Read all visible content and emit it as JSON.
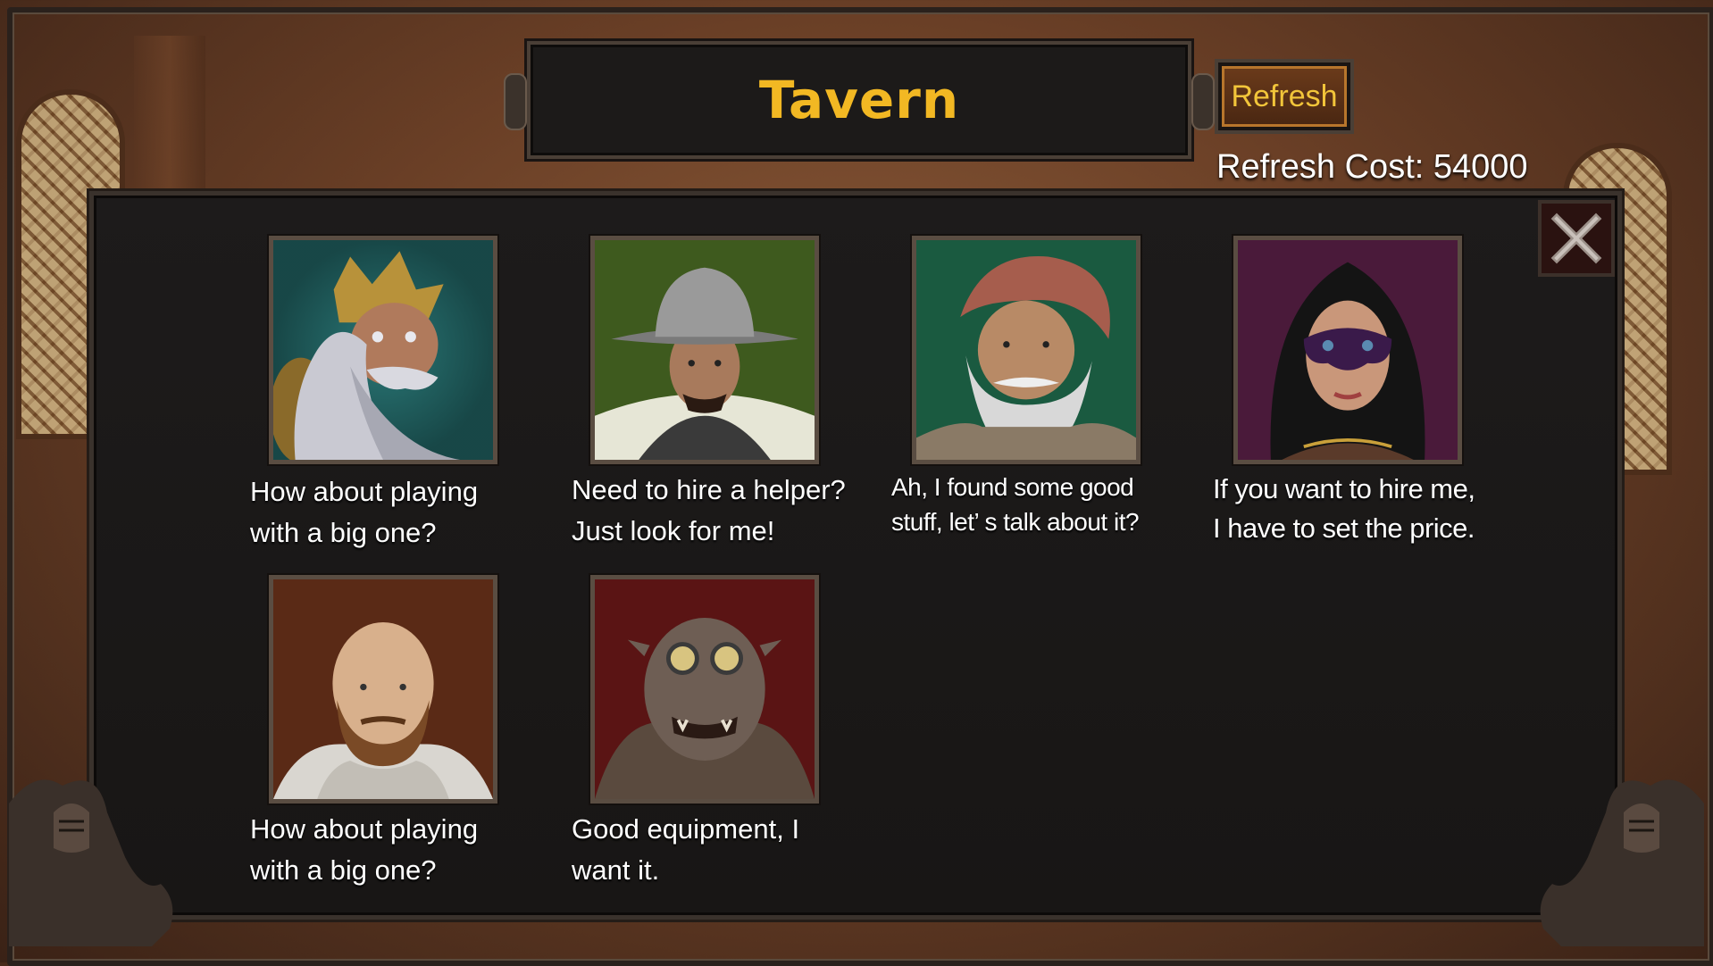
{
  "header": {
    "title": "Tavern",
    "refresh_label": "Refresh",
    "refresh_cost_text": "Refresh Cost: 54000"
  },
  "icons": {
    "close": "close-icon"
  },
  "heroes": [
    {
      "id": "dwarf-king",
      "quote": "How about playing\nwith a big one?"
    },
    {
      "id": "soldier",
      "quote": "Need to hire a helper?\nJust look for me!"
    },
    {
      "id": "turban-elder",
      "quote": "Ah, I found some good\nstuff, let’ s talk about it?"
    },
    {
      "id": "masked-woman",
      "quote": "If you want to hire me,\nI have to set the price."
    },
    {
      "id": "bald-monk",
      "quote": "How about playing\nwith a big one?"
    },
    {
      "id": "goggled-orc",
      "quote": "Good equipment, I\nwant it."
    }
  ],
  "colors": {
    "title": "#f2b823",
    "refresh_text": "#f2c53a",
    "panel": "#1d1b1b",
    "frame": "#4a3f36"
  }
}
